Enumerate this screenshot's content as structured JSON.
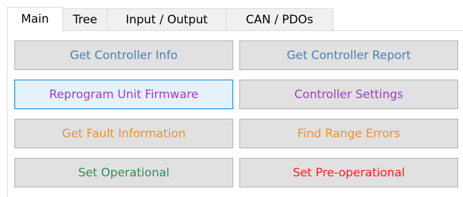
{
  "tabs": [
    {
      "label": "Main",
      "selected": true
    },
    {
      "label": "Tree",
      "selected": false
    },
    {
      "label": "Input / Output",
      "selected": false
    },
    {
      "label": "CAN / PDOs",
      "selected": false
    }
  ],
  "buttons": {
    "get_controller_info": {
      "label": "Get Controller Info",
      "color": "#4a80b8"
    },
    "get_controller_report": {
      "label": "Get Controller Report",
      "color": "#4a80b8"
    },
    "reprogram_unit_firmware": {
      "label": "Reprogram Unit Firmware",
      "color": "#9b3fc4",
      "focused": true
    },
    "controller_settings": {
      "label": "Controller Settings",
      "color": "#9b3fc4"
    },
    "get_fault_information": {
      "label": "Get Fault Information",
      "color": "#f0902b"
    },
    "find_range_errors": {
      "label": "Find Range Errors",
      "color": "#f0902b"
    },
    "set_operational": {
      "label": "Set Operational",
      "color": "#2e8b57"
    },
    "set_pre_operational": {
      "label": "Set Pre-operational",
      "color": "#ff1a1a"
    }
  }
}
